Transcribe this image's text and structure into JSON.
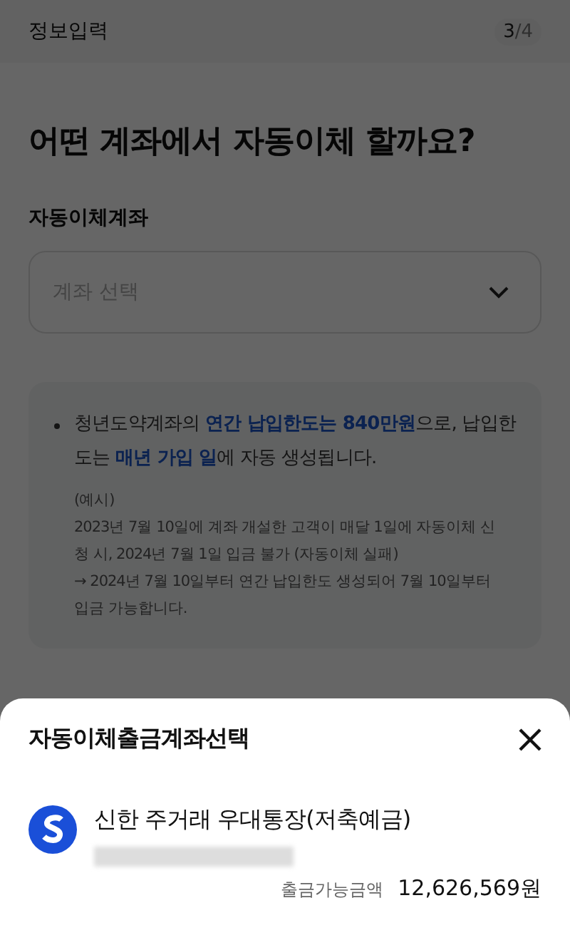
{
  "header": {
    "title": "정보입력",
    "step_current": "3",
    "step_separator": "/",
    "step_total": "4"
  },
  "heading": "어떤 계좌에서 자동이체 할까요?",
  "account_field": {
    "label": "자동이체계좌",
    "placeholder": "계좌 선택"
  },
  "notice": {
    "segments": [
      {
        "text": "청년도약계좌의 ",
        "highlight": false
      },
      {
        "text": "연간 납입한도는 840만원",
        "highlight": true
      },
      {
        "text": "으로, 납입한도는 ",
        "highlight": false
      },
      {
        "text": "매년 가입 일",
        "highlight": true
      },
      {
        "text": "에 자동 생성됩니다.",
        "highlight": false
      }
    ],
    "example_lines": [
      "(예시)",
      "2023년 7월 10일에 계좌 개설한 고객이 매달 1일에 자동이체 신청 시, 2024년 7월 1일 입금 불가 (자동이체 실패)",
      "→ 2024년 7월 10일부터 연간 납입한도 생성되어 7월 10일부터 입금 가능합니다."
    ]
  },
  "sheet": {
    "title": "자동이체출금계좌선택",
    "accounts": [
      {
        "name": "신한 주거래 우대통장(저축예금)",
        "balance_label": "출금가능금액",
        "balance": "12,626,569원"
      }
    ]
  }
}
